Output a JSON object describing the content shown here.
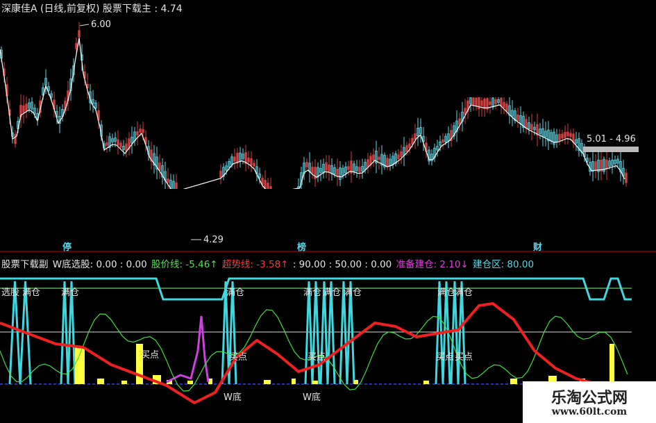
{
  "main": {
    "header": {
      "stock": "深康佳A",
      "mode": "(日线,前复权)",
      "indicator": "股票下载主",
      "value": ": 4.74"
    },
    "high_label": "6.00",
    "low_label": "4.29",
    "range_label": "5.01 - 4.96",
    "markers": [
      "停",
      "榜",
      "财"
    ]
  },
  "sub": {
    "header": [
      {
        "text": "股票下载副",
        "color": "white"
      },
      {
        "text": "W底选股: 0.00 : 0.00",
        "color": "white"
      },
      {
        "text": "股价线: -5.46↑",
        "color": "green"
      },
      {
        "text": "超势线: -3.58↑",
        "color": "red"
      },
      {
        "text": ": 90.00 : 50.00 : 0.00",
        "color": "white"
      },
      {
        "text": "准备建仓: 2.10↓",
        "color": "magenta"
      },
      {
        "text": "建仓区: 80.00",
        "color": "cyan"
      }
    ],
    "labels": {
      "xuangu": "选股",
      "mancang": "满仓",
      "maidian": "买点",
      "wdi": "W底"
    }
  },
  "watermark": {
    "title": "乐淘公式网",
    "url": "www.60lt.com"
  },
  "colors": {
    "up": "#60d8e8",
    "down": "#d04040",
    "ma": "#ffffff",
    "green_line": "#40e040",
    "red_line": "#ee2020",
    "cyan_band": "#40d8e0",
    "yellow_bar": "#ffff40",
    "magenta": "#d040e0",
    "blue_dash": "#3040ff"
  }
}
